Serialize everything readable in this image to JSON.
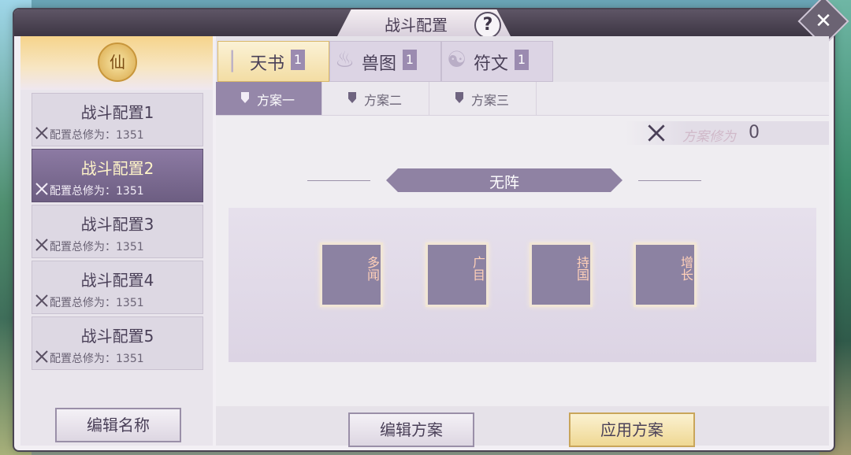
{
  "window": {
    "title": "战斗配置",
    "help_label": "?",
    "close_label": "✕"
  },
  "sidebar": {
    "badge": "仙",
    "configs": [
      {
        "name": "战斗配置1",
        "power": "配置总修为：1351",
        "selected": false
      },
      {
        "name": "战斗配置2",
        "power": "配置总修为：1351",
        "selected": true
      },
      {
        "name": "战斗配置3",
        "power": "配置总修为：1351",
        "selected": false
      },
      {
        "name": "战斗配置4",
        "power": "配置总修为：1351",
        "selected": false
      },
      {
        "name": "战斗配置5",
        "power": "配置总修为：1351",
        "selected": false
      }
    ],
    "edit_name_label": "编辑名称"
  },
  "main": {
    "top_tabs": [
      {
        "label": "天书",
        "count": "1",
        "active": true
      },
      {
        "label": "兽图",
        "count": "1",
        "active": false
      },
      {
        "label": "符文",
        "count": "1",
        "active": false
      }
    ],
    "sub_tabs": [
      {
        "label": "方案一",
        "active": true
      },
      {
        "label": "方案二",
        "active": false
      },
      {
        "label": "方案三",
        "active": false
      }
    ],
    "cultivation": {
      "label": "方案修为",
      "value": "0"
    },
    "formation": {
      "name": "无阵"
    },
    "slots": [
      "多闻",
      "广目",
      "持国",
      "增长"
    ],
    "edit_plan_label": "编辑方案",
    "apply_plan_label": "应用方案"
  },
  "colors": {
    "accent_purple": "#8f82a3",
    "gold": "#efd893",
    "selected_item": "#6d5e82"
  }
}
